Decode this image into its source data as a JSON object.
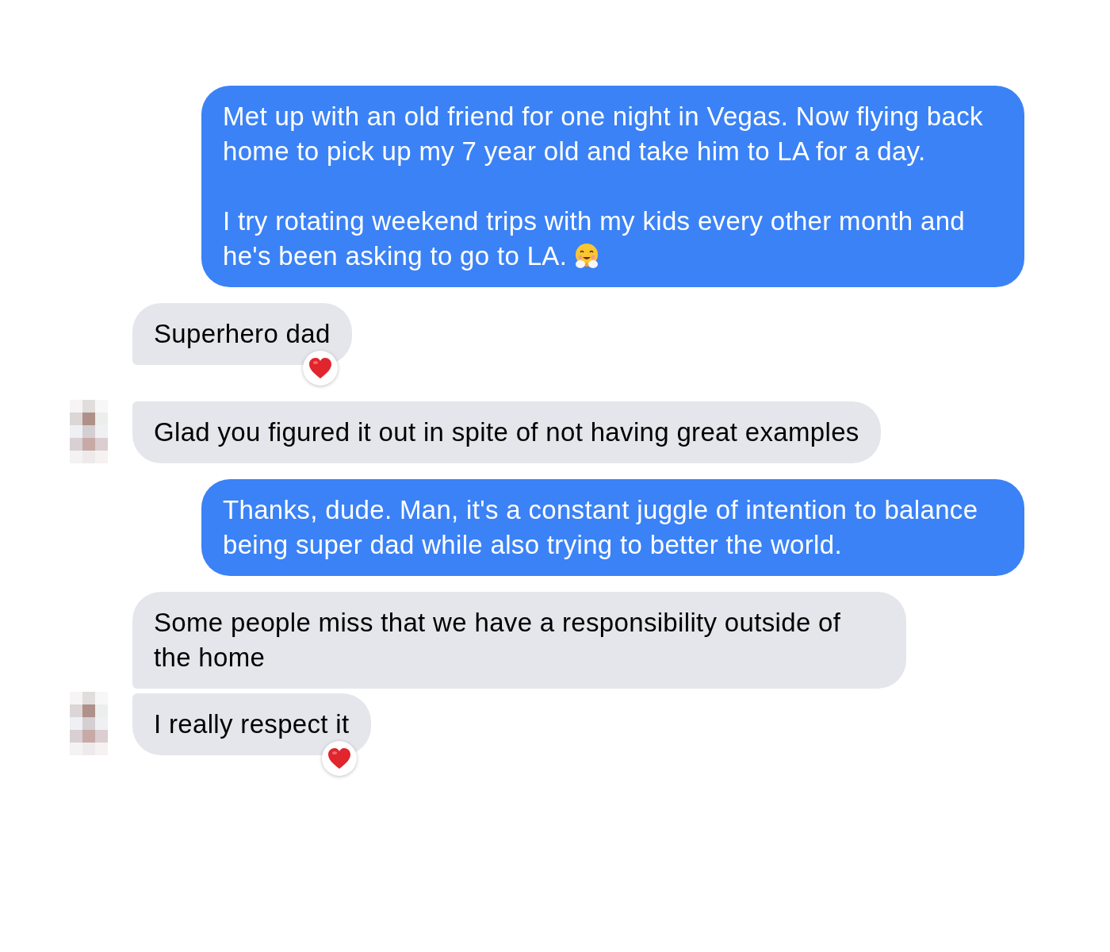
{
  "messages": [
    {
      "kind": "sent",
      "text": "Met up with an old friend for one night in Vegas. Now flying back home to pick up my 7 year old and take him to LA for a day.\n\nI try rotating weekend trips with my kids every other month and he's been asking to go to LA.",
      "emoji": true
    },
    {
      "kind": "received",
      "text": "Superhero dad",
      "heart": true
    },
    {
      "kind": "received",
      "text": "Glad you figured it out in spite of not having great examples",
      "avatar": true
    },
    {
      "kind": "sent",
      "text": "Thanks, dude.  Man, it's a constant juggle of intention to balance being super dad while also trying to better the world."
    },
    {
      "kind": "received",
      "text": "Some people miss that we have a responsibility outside of the home"
    },
    {
      "kind": "received",
      "text": "I really respect it",
      "heart": true,
      "avatar": true
    }
  ]
}
